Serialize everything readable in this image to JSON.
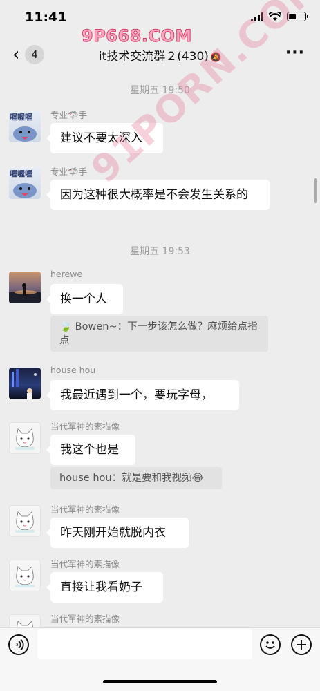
{
  "status_bar": {
    "time": "11:41"
  },
  "watermarks": {
    "top": "9P668.COM",
    "diagonal": "91PORN.COM"
  },
  "nav": {
    "back_badge": "4",
    "title": "it技术交流群２(430)",
    "mute_icon": "bell-slash",
    "more_icon": "ellipsis"
  },
  "chat": {
    "timestamps": [
      "星期五 19:50",
      "星期五 19:53"
    ],
    "messages": [
      {
        "sender": "专业🦈手",
        "avatar": "shark",
        "text": "建议不要太深入"
      },
      {
        "sender": "专业🦈手",
        "avatar": "shark",
        "text": "因为这种很大概率是不会发生关系的"
      },
      {
        "sender": "herewe",
        "avatar": "sunset",
        "text": "换一个人",
        "quote": "🍃 Bowen~：下一步该怎么做？麻烦给点指点"
      },
      {
        "sender": "house hou",
        "avatar": "night-city",
        "text": "我最近遇到一个，要玩字母，"
      },
      {
        "sender": "当代军神的素描像",
        "avatar": "cat",
        "text": "我这个也是",
        "quote": "house hou：就是要和我视频😂"
      },
      {
        "sender": "当代军神的素描像",
        "avatar": "cat",
        "text": "昨天刚开始就脱内衣"
      },
      {
        "sender": "当代军神的素描像",
        "avatar": "cat",
        "text": "直接让我看奶子"
      },
      {
        "sender": "当代军神的素描像",
        "avatar": "cat",
        "text": ""
      }
    ]
  },
  "input_bar": {
    "voice_icon": "voice-icon",
    "emoji_icon": "emoji-icon",
    "plus_icon": "plus-icon",
    "text": ""
  }
}
